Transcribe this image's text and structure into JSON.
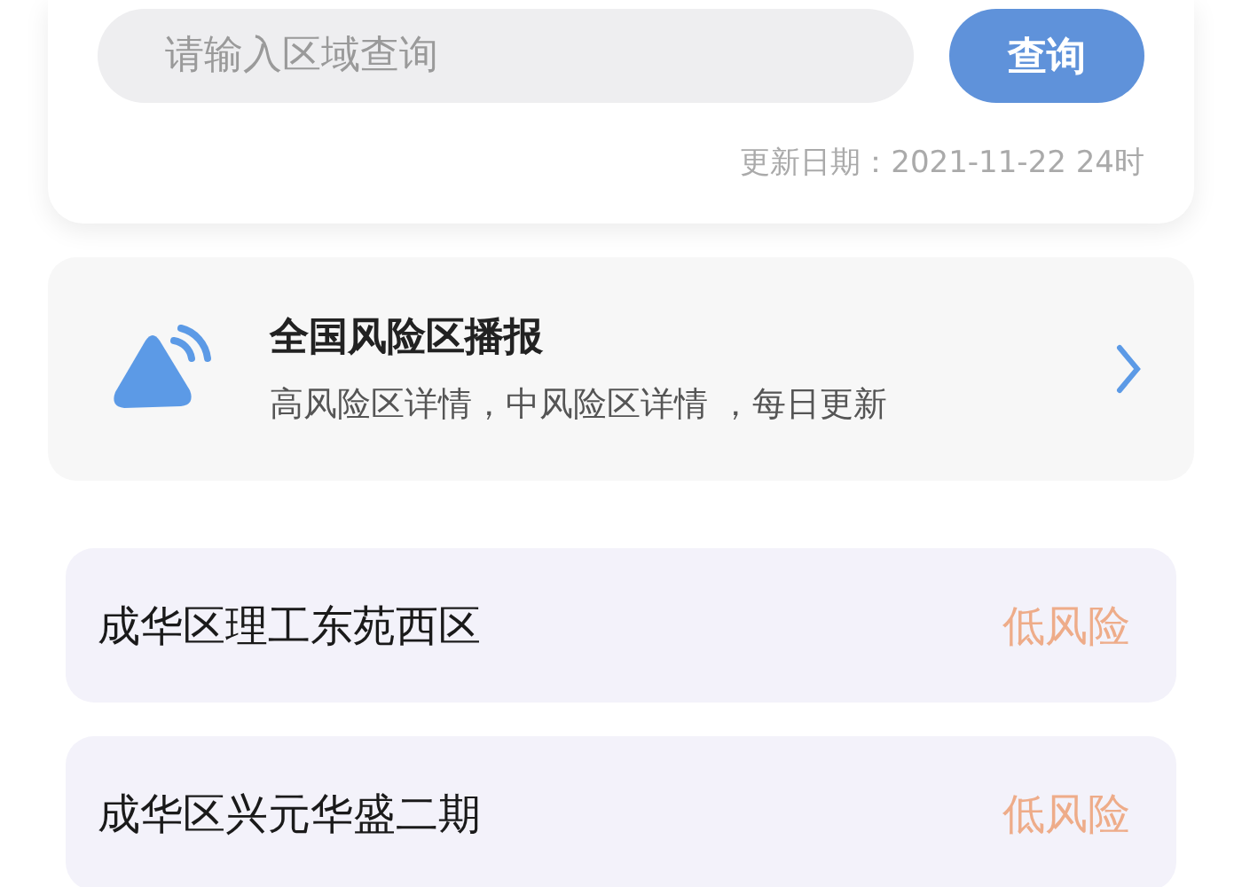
{
  "search": {
    "placeholder": "请输入区域查询",
    "button": "查询",
    "update_date": "更新日期：2021-11-22 24时"
  },
  "broadcast": {
    "title": "全国风险区播报",
    "subtitle": "高风险区详情，中风险区详情 ，每日更新"
  },
  "areas": [
    {
      "name": "成华区理工东苑西区",
      "risk": "低风险",
      "color": "#eeac89"
    },
    {
      "name": "成华区兴元华盛二期",
      "risk": "低风险",
      "color": "#eeac89"
    }
  ]
}
